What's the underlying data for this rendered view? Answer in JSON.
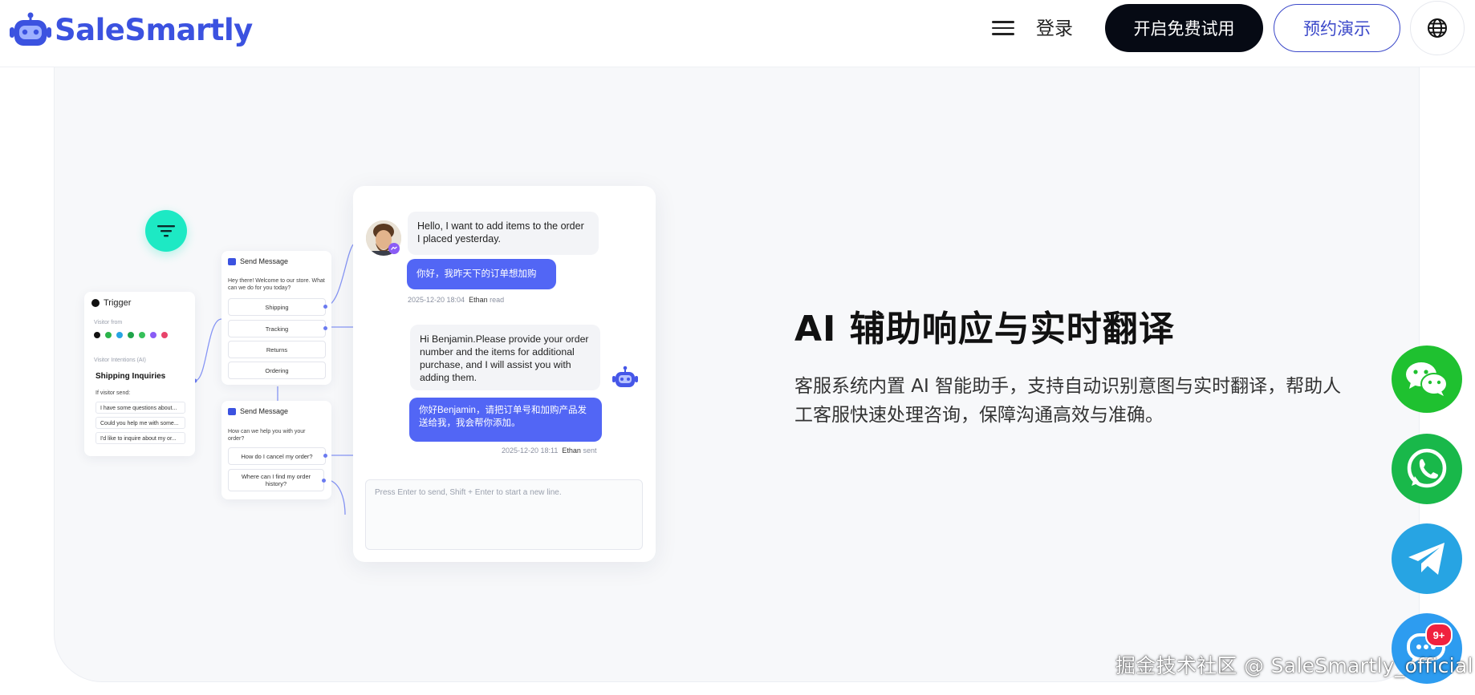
{
  "header": {
    "brand": "SaleSmartly",
    "login_label": "登录",
    "trial_button": "开启免费试用",
    "demo_button": "预约演示"
  },
  "feature": {
    "title": "AI 辅助响应与实时翻译",
    "description": "客服系统内置 AI 智能助手，支持自动识别意图与实时翻译，帮助人工客服快速处理咨询，保障沟通高效与准确。"
  },
  "flow": {
    "trigger_label": "Trigger",
    "visitor_from": "Visitor from",
    "visitor_intentions": "Visitor Intentions (AI)",
    "intent_title": "Shipping Inquiries",
    "if_visitor_send": "If visitor send:",
    "intent_items": [
      "I have some questions about...",
      "Could you help me with some...",
      "I'd like to inquire about my or..."
    ],
    "send_message_1": {
      "title": "Send Message",
      "text": "Hey there! Welcome to our store. What can we do for you today?",
      "options": [
        "Shipping",
        "Tracking",
        "Returns",
        "Ordering"
      ]
    },
    "send_message_2": {
      "title": "Send Message",
      "text": "How can we help you with your order?",
      "options": [
        "How do I cancel my order?",
        "Where can I find my order history?"
      ]
    }
  },
  "chat": {
    "msg_in_1": "Hello, I want to add items to the order I placed yesterday.",
    "translation_1": "你好，我昨天下的订单想加购",
    "meta_1_time": "2025-12-20 18:04",
    "meta_1_agent": "Ethan",
    "meta_1_status": "read",
    "msg_reply": "Hi Benjamin.Please provide your order number and the items for additional purchase, and I will assist you with adding them.",
    "translation_2": "你好Benjamin，请把订单号和加购产品发送给我，我会帮你添加。",
    "meta_2_time": "2025-12-20 18:11",
    "meta_2_agent": "Ethan",
    "meta_2_status": "sent",
    "input_placeholder": "Press Enter to send,  Shift + Enter to start a new line."
  },
  "floating": {
    "badge": "9+"
  },
  "watermark": "掘金技术社区 @ SaleSmartly_official",
  "colors": {
    "brand_blue": "#3b52e0",
    "accent_teal": "#1de9c4",
    "wechat_green": "#1fc130",
    "whatsapp_green": "#19b84a",
    "telegram_blue": "#27a4e3",
    "bubble_blue": "#5266f5"
  }
}
